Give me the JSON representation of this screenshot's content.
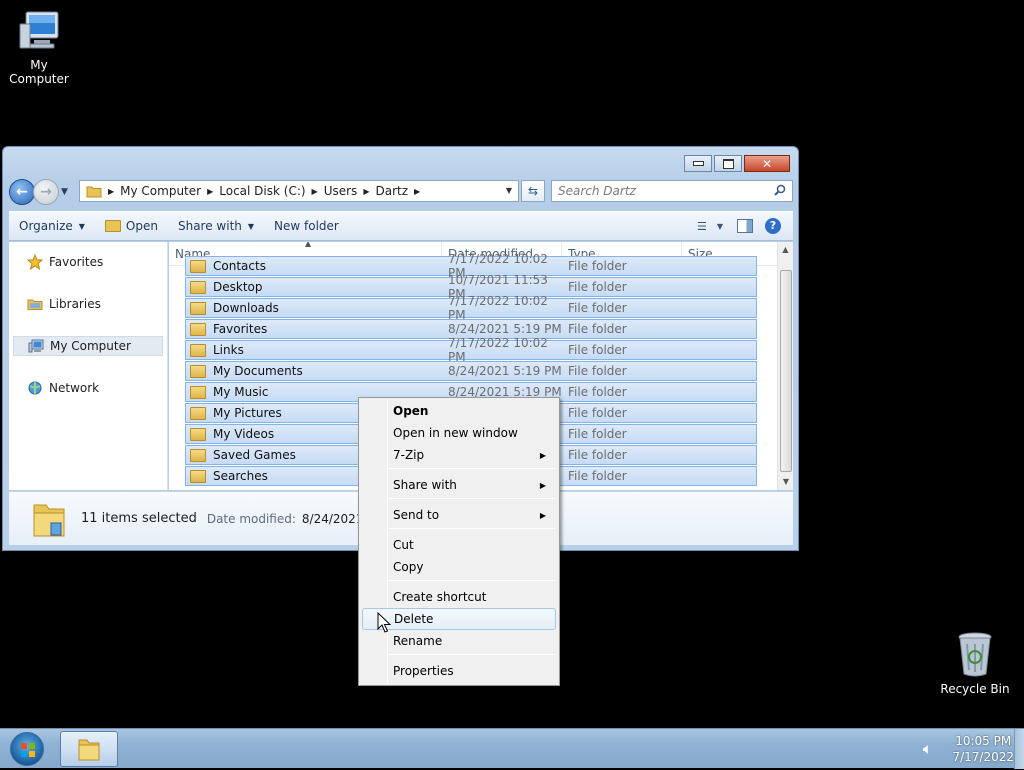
{
  "desktop": {
    "icons": [
      {
        "label": "My Computer",
        "icon": "computer-icon"
      },
      {
        "label": "Recycle Bin",
        "icon": "recycle-bin-icon"
      }
    ]
  },
  "window": {
    "breadcrumb": [
      "My Computer",
      "Local Disk (C:)",
      "Users",
      "Dartz"
    ],
    "search_placeholder": "Search Dartz",
    "toolbar": {
      "organize": "Organize",
      "open": "Open",
      "share_with": "Share with",
      "new_folder": "New folder"
    },
    "nav": [
      {
        "label": "Favorites",
        "icon": "star-icon"
      },
      {
        "label": "Libraries",
        "icon": "libraries-icon"
      },
      {
        "label": "My Computer",
        "icon": "computer-icon"
      },
      {
        "label": "Network",
        "icon": "network-icon"
      }
    ],
    "columns": [
      "Name",
      "Date modified",
      "Type",
      "Size"
    ],
    "rows": [
      {
        "name": "Contacts",
        "date": "7/17/2022 10:02 PM",
        "type": "File folder"
      },
      {
        "name": "Desktop",
        "date": "10/7/2021 11:53 PM",
        "type": "File folder"
      },
      {
        "name": "Downloads",
        "date": "7/17/2022 10:02 PM",
        "type": "File folder"
      },
      {
        "name": "Favorites",
        "date": "8/24/2021 5:19 PM",
        "type": "File folder"
      },
      {
        "name": "Links",
        "date": "7/17/2022 10:02 PM",
        "type": "File folder"
      },
      {
        "name": "My Documents",
        "date": "8/24/2021 5:19 PM",
        "type": "File folder"
      },
      {
        "name": "My Music",
        "date": "8/24/2021 5:19 PM",
        "type": "File folder"
      },
      {
        "name": "My Pictures",
        "date": "",
        "type": "File folder"
      },
      {
        "name": "My Videos",
        "date": "",
        "type": "File folder"
      },
      {
        "name": "Saved Games",
        "date": "",
        "type": "File folder"
      },
      {
        "name": "Searches",
        "date": "",
        "type": "File folder"
      }
    ],
    "details": {
      "count": "11 items selected",
      "date_label": "Date modified:",
      "date_value": "8/24/2021 5:19"
    }
  },
  "context_menu": {
    "items": [
      {
        "label": "Open",
        "bold": true
      },
      {
        "label": "Open in new window"
      },
      {
        "label": "7-Zip",
        "submenu": true
      },
      {
        "label": "Share with",
        "submenu": true
      },
      {
        "label": "Send to",
        "submenu": true
      },
      {
        "label": "Cut"
      },
      {
        "label": "Copy"
      },
      {
        "label": "Create shortcut"
      },
      {
        "label": "Delete",
        "hovered": true
      },
      {
        "label": "Rename"
      },
      {
        "label": "Properties"
      }
    ]
  },
  "taskbar": {
    "time": "10:05 PM",
    "date": "7/17/2022"
  },
  "colors": {
    "selection": "#c6dcf5",
    "selection_border": "#86b3e6",
    "taskbar": "#8fb1d3"
  }
}
